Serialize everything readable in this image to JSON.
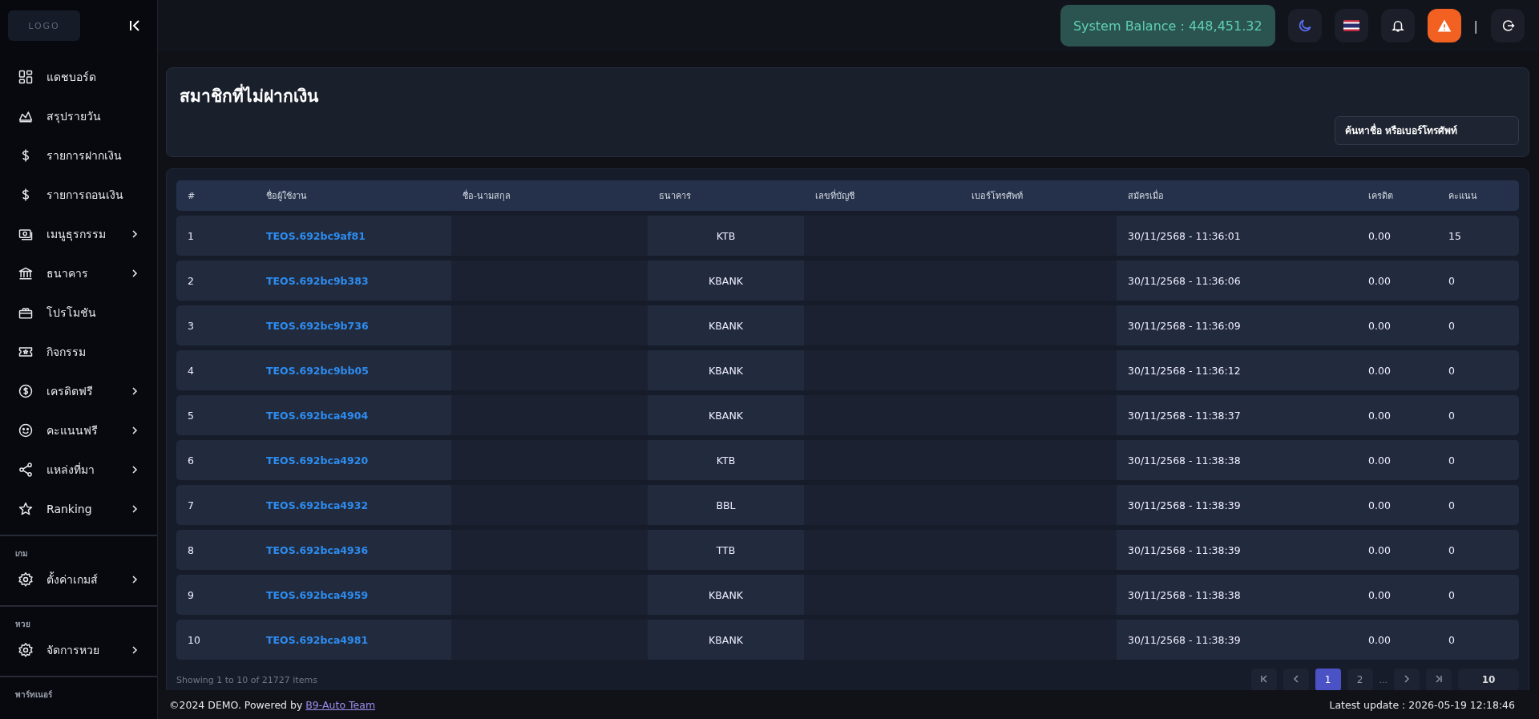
{
  "sidebar": {
    "logo": "LOGO",
    "items": [
      {
        "label": "แดชบอร์ด",
        "expandable": false
      },
      {
        "label": "สรุปรายวัน",
        "expandable": false
      },
      {
        "label": "รายการฝากเงิน",
        "expandable": false
      },
      {
        "label": "รายการถอนเงิน",
        "expandable": false
      },
      {
        "label": "เมนูธุรกรรม",
        "expandable": true
      },
      {
        "label": "ธนาคาร",
        "expandable": true
      },
      {
        "label": "โปรโมชัน",
        "expandable": false
      },
      {
        "label": "กิจกรรม",
        "expandable": false
      },
      {
        "label": "เครดิตฟรี",
        "expandable": true
      },
      {
        "label": "คะแนนฟรี",
        "expandable": true
      },
      {
        "label": "แหล่งที่มา",
        "expandable": true
      },
      {
        "label": "Ranking",
        "expandable": true
      }
    ],
    "sections": [
      {
        "title": "เกม",
        "items": [
          {
            "label": "ตั้งค่าเกมส์",
            "expandable": true
          }
        ]
      },
      {
        "title": "หวย",
        "items": [
          {
            "label": "จัดการหวย",
            "expandable": true
          }
        ]
      },
      {
        "title": "พาร์ทเนอร์"
      }
    ]
  },
  "topbar": {
    "balance": "System Balance : 448,451.32",
    "separator": "|"
  },
  "page": {
    "title": "สมาชิกที่ไม่ฝากเงิน",
    "search": {
      "placeholder": "ค้นหาชื่อ หรือเบอร์โทรศัพท์"
    }
  },
  "table": {
    "columns": [
      "#",
      "ชื่อผู้ใช้งาน",
      "ชื่อ-นามสกุล",
      "ธนาคาร",
      "เลขที่บัญชี",
      "เบอร์โทรศัพท์",
      "สมัครเมื่อ",
      "เครดิต",
      "คะแนน"
    ],
    "rows": [
      [
        "1",
        "TEOS.692bc9af81",
        "",
        "KTB",
        "",
        "",
        "30/11/2568 - 11:36:01",
        "0.00",
        "15"
      ],
      [
        "2",
        "TEOS.692bc9b383",
        "",
        "KBANK",
        "",
        "",
        "30/11/2568 - 11:36:06",
        "0.00",
        "0"
      ],
      [
        "3",
        "TEOS.692bc9b736",
        "",
        "KBANK",
        "",
        "",
        "30/11/2568 - 11:36:09",
        "0.00",
        "0"
      ],
      [
        "4",
        "TEOS.692bc9bb05",
        "",
        "KBANK",
        "",
        "",
        "30/11/2568 - 11:36:12",
        "0.00",
        "0"
      ],
      [
        "5",
        "TEOS.692bca4904",
        "",
        "KBANK",
        "",
        "",
        "30/11/2568 - 11:38:37",
        "0.00",
        "0"
      ],
      [
        "6",
        "TEOS.692bca4920",
        "",
        "KTB",
        "",
        "",
        "30/11/2568 - 11:38:38",
        "0.00",
        "0"
      ],
      [
        "7",
        "TEOS.692bca4932",
        "",
        "BBL",
        "",
        "",
        "30/11/2568 - 11:38:39",
        "0.00",
        "0"
      ],
      [
        "8",
        "TEOS.692bca4936",
        "",
        "TTB",
        "",
        "",
        "30/11/2568 - 11:38:39",
        "0.00",
        "0"
      ],
      [
        "9",
        "TEOS.692bca4959",
        "",
        "KBANK",
        "",
        "",
        "30/11/2568 - 11:38:38",
        "0.00",
        "0"
      ],
      [
        "10",
        "TEOS.692bca4981",
        "",
        "KBANK",
        "",
        "",
        "30/11/2568 - 11:38:39",
        "0.00",
        "0"
      ]
    ]
  },
  "pagination": {
    "summary": "Showing 1 to 10 of 21727 items",
    "pages": [
      {
        "label": "1",
        "selected": true
      },
      {
        "label": "2",
        "selected": false
      }
    ],
    "ellipsis": "...",
    "page_size": "10"
  },
  "footer": {
    "copyright": "©2024 DEMO. Powered by ",
    "link": "B9-Auto Team",
    "updated": "Latest update : 2026-05-19 12:18:46"
  }
}
